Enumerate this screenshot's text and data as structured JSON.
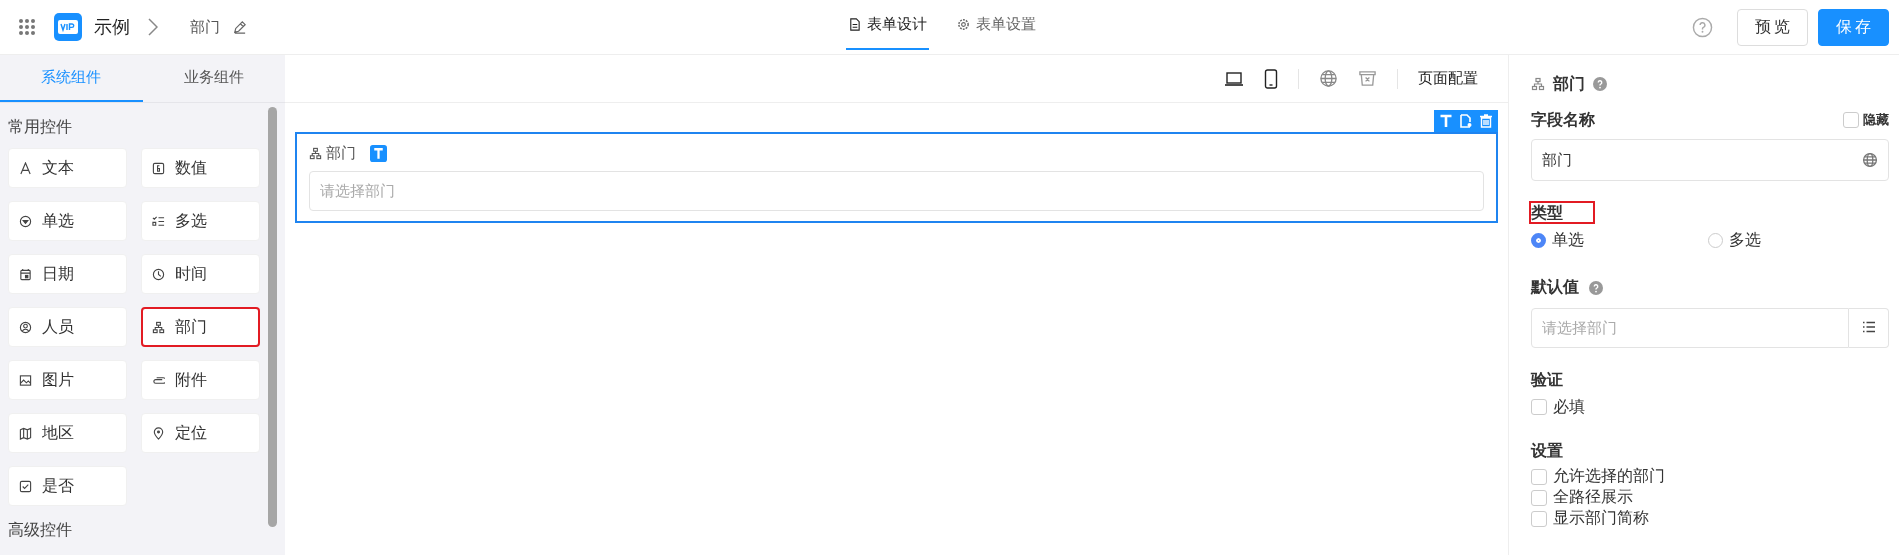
{
  "header": {
    "app_name": "示例",
    "page_name": "部门",
    "tabs": [
      {
        "label": "表单设计",
        "kind": "doc",
        "selected": true
      },
      {
        "label": "表单设置",
        "kind": "gear",
        "selected": false
      }
    ],
    "buttons": [
      {
        "label": "预览",
        "kind": "secondary"
      },
      {
        "label": "保存",
        "kind": "primary"
      }
    ]
  },
  "sidebar": {
    "tabs": [
      {
        "label": "系统组件",
        "selected": true
      },
      {
        "label": "业务组件",
        "selected": false
      }
    ],
    "groups": [
      {
        "title": "常用控件",
        "items": [
          {
            "label": "文本",
            "kind": "text",
            "highlighted": false
          },
          {
            "label": "数值",
            "kind": "number",
            "highlighted": false
          },
          {
            "label": "单选",
            "kind": "radio",
            "highlighted": false
          },
          {
            "label": "多选",
            "kind": "checklist",
            "highlighted": false
          },
          {
            "label": "日期",
            "kind": "date",
            "highlighted": false
          },
          {
            "label": "时间",
            "kind": "time",
            "highlighted": false
          },
          {
            "label": "人员",
            "kind": "person",
            "highlighted": false
          },
          {
            "label": "部门",
            "kind": "org",
            "highlighted": true
          },
          {
            "label": "图片",
            "kind": "image",
            "highlighted": false
          },
          {
            "label": "附件",
            "kind": "clip",
            "highlighted": false
          },
          {
            "label": "地区",
            "kind": "map",
            "highlighted": false
          },
          {
            "label": "定位",
            "kind": "pin",
            "highlighted": false
          },
          {
            "label": "是否",
            "kind": "check",
            "highlighted": false
          }
        ]
      },
      {
        "title": "高级控件"
      }
    ]
  },
  "canvas": {
    "toolbar_link": "页面配置",
    "field": {
      "label": "部门",
      "placeholder": "请选择部门",
      "selected": true
    }
  },
  "properties": {
    "title": "部门",
    "field_name": {
      "label": "字段名称",
      "value": "部门",
      "hidden_label": "隐藏",
      "hidden": false
    },
    "type": {
      "label": "类型",
      "highlighted": true,
      "options": [
        {
          "label": "单选",
          "selected": true
        },
        {
          "label": "多选",
          "selected": false
        }
      ]
    },
    "default": {
      "label": "默认值",
      "placeholder": "请选择部门"
    },
    "validation": {
      "label": "验证",
      "options": [
        {
          "label": "必填",
          "checked": false
        }
      ]
    },
    "settings": {
      "label": "设置",
      "options": [
        {
          "label": "允许选择的部门",
          "checked": false
        },
        {
          "label": "全路径展示",
          "checked": false
        },
        {
          "label": "显示部门简称",
          "checked": false
        }
      ]
    }
  }
}
